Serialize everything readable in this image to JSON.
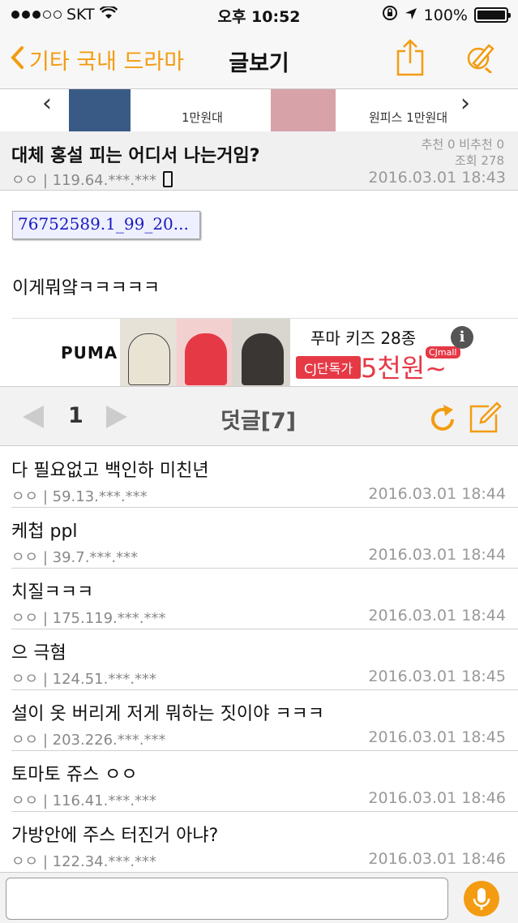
{
  "status_bar": {
    "carrier": "SKT",
    "time": "오후 10:52",
    "battery": "100%"
  },
  "nav": {
    "back_label": "기타 국내 드라마",
    "title": "글보기"
  },
  "ad_strip": {
    "caption_1": "1만원대",
    "caption_2": "원피스 1만원대"
  },
  "post": {
    "title": "대체 홍설 피는 어디서 나는거임?",
    "recommend": "추천 0 비추천 0",
    "views": "조회 278",
    "author": "ㅇㅇ | 119.64.***.***",
    "date": "2016.03.01 18:43",
    "attachment": "76752589.1_99_20...",
    "body": "이게뭐얔ㅋㅋㅋㅋㅋ"
  },
  "puma_ad": {
    "logo": "PUMA",
    "headline": "푸마 키즈 28종",
    "badge": "CJ단독가",
    "price": "5천원~",
    "mall": "CJmall"
  },
  "comments_header": {
    "page": "1",
    "title": "덧글[7]"
  },
  "comments": [
    {
      "text": "다 필요없고 백인하 미친년",
      "meta": "ㅇㅇ | 59.13.***.***",
      "date": "2016.03.01 18:44"
    },
    {
      "text": "케첩 ppl",
      "meta": "ㅇㅇ | 39.7.***.***",
      "date": "2016.03.01 18:44"
    },
    {
      "text": "치질ㅋㅋㅋ",
      "meta": "ㅇㅇ | 175.119.***.***",
      "date": "2016.03.01 18:44"
    },
    {
      "text": "으 극혐",
      "meta": "ㅇㅇ | 124.51.***.***",
      "date": "2016.03.01 18:45"
    },
    {
      "text": "설이 옷 버리게 저게 뭐하는 짓이야 ㅋㅋㅋ",
      "meta": "ㅇㅇ | 203.226.***.***",
      "date": "2016.03.01 18:45"
    },
    {
      "text": "토마토 쥬스 ㅇㅇ",
      "meta": "ㅇㅇ | 116.41.***.***",
      "date": "2016.03.01 18:46"
    },
    {
      "text": "가방안에 주스 터진거 아냐?",
      "meta": "ㅇㅇ | 122.34.***.***",
      "date": "2016.03.01 18:46"
    }
  ],
  "input": {
    "placeholder": ""
  },
  "colors": {
    "accent": "#f39c12"
  }
}
